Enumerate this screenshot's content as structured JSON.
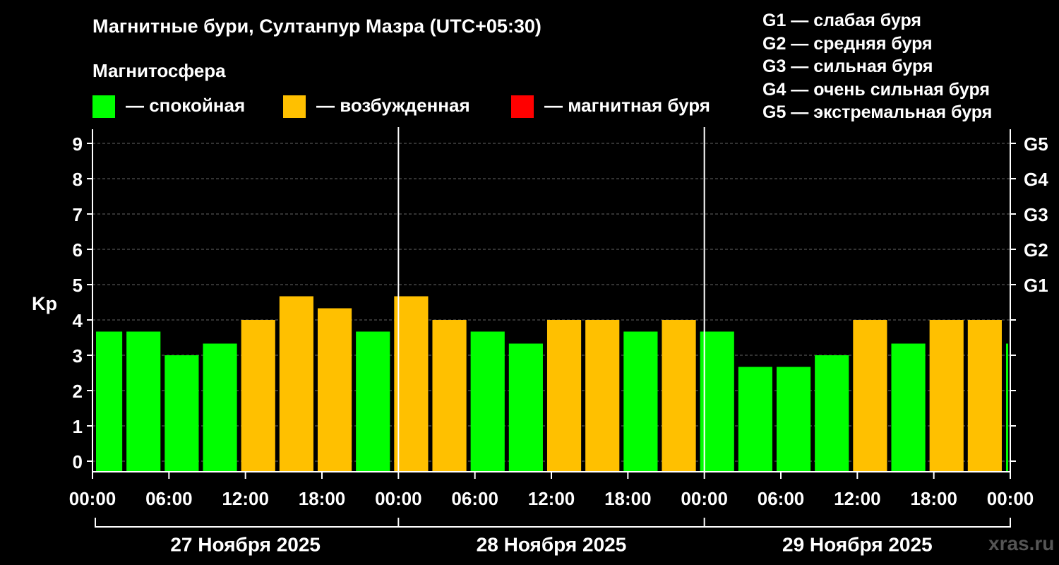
{
  "title": "Магнитные бури, Султанпур Мазра (UTC+05:30)",
  "magnetosphere_label": "Магнитосфера",
  "legend": [
    {
      "color": "#00ff00",
      "label": "— спокойная"
    },
    {
      "color": "#ffc000",
      "label": "— возбужденная"
    },
    {
      "color": "#ff0000",
      "label": "— магнитная буря"
    }
  ],
  "storm_levels": [
    "G1 — слабая буря",
    "G2 — средняя буря",
    "G3 — сильная буря",
    "G4 — очень сильная буря",
    "G5 — экстремальная буря"
  ],
  "watermark": "xras.ru",
  "chart_data": {
    "type": "bar",
    "ylabel": "Kp",
    "ylim": [
      -0.3,
      9.4
    ],
    "yticks": [
      "0",
      "1",
      "2",
      "3",
      "4",
      "5",
      "6",
      "7",
      "8",
      "9"
    ],
    "right_ticks": [
      {
        "value": 5,
        "label": "G1"
      },
      {
        "value": 6,
        "label": "G2"
      },
      {
        "value": 7,
        "label": "G3"
      },
      {
        "value": 8,
        "label": "G4"
      },
      {
        "value": 9,
        "label": "G5"
      }
    ],
    "grid": "horizontal dashed",
    "x_tick_labels": [
      "00:00",
      "06:00",
      "12:00",
      "18:00",
      "00:00",
      "06:00",
      "12:00",
      "18:00",
      "00:00",
      "06:00",
      "12:00",
      "18:00",
      "00:00"
    ],
    "days": [
      "27 Ноября 2025",
      "28 Ноября 2025",
      "29 Ноября 2025"
    ],
    "bars": [
      {
        "start_hour": 0,
        "end_hour": 2.5,
        "kp": 3.67,
        "state": "quiet"
      },
      {
        "start_hour": 2.5,
        "end_hour": 5.5,
        "kp": 3.67,
        "state": "quiet"
      },
      {
        "start_hour": 5.5,
        "end_hour": 8.5,
        "kp": 3.0,
        "state": "quiet"
      },
      {
        "start_hour": 8.5,
        "end_hour": 11.5,
        "kp": 3.33,
        "state": "quiet"
      },
      {
        "start_hour": 11.5,
        "end_hour": 14.5,
        "kp": 4.0,
        "state": "active"
      },
      {
        "start_hour": 14.5,
        "end_hour": 17.5,
        "kp": 4.67,
        "state": "active"
      },
      {
        "start_hour": 17.5,
        "end_hour": 20.5,
        "kp": 4.33,
        "state": "active"
      },
      {
        "start_hour": 20.5,
        "end_hour": 23.5,
        "kp": 3.67,
        "state": "quiet"
      },
      {
        "start_hour": 23.5,
        "end_hour": 26.5,
        "kp": 4.67,
        "state": "active"
      },
      {
        "start_hour": 26.5,
        "end_hour": 29.5,
        "kp": 4.0,
        "state": "active"
      },
      {
        "start_hour": 29.5,
        "end_hour": 32.5,
        "kp": 3.67,
        "state": "quiet"
      },
      {
        "start_hour": 32.5,
        "end_hour": 35.5,
        "kp": 3.33,
        "state": "quiet"
      },
      {
        "start_hour": 35.5,
        "end_hour": 38.5,
        "kp": 4.0,
        "state": "active"
      },
      {
        "start_hour": 38.5,
        "end_hour": 41.5,
        "kp": 4.0,
        "state": "active"
      },
      {
        "start_hour": 41.5,
        "end_hour": 44.5,
        "kp": 3.67,
        "state": "quiet"
      },
      {
        "start_hour": 44.5,
        "end_hour": 47.5,
        "kp": 4.0,
        "state": "active"
      },
      {
        "start_hour": 47.5,
        "end_hour": 50.5,
        "kp": 3.67,
        "state": "quiet"
      },
      {
        "start_hour": 50.5,
        "end_hour": 53.5,
        "kp": 2.67,
        "state": "quiet"
      },
      {
        "start_hour": 53.5,
        "end_hour": 56.5,
        "kp": 2.67,
        "state": "quiet"
      },
      {
        "start_hour": 56.5,
        "end_hour": 59.5,
        "kp": 3.0,
        "state": "quiet"
      },
      {
        "start_hour": 59.5,
        "end_hour": 62.5,
        "kp": 4.0,
        "state": "active"
      },
      {
        "start_hour": 62.5,
        "end_hour": 65.5,
        "kp": 3.33,
        "state": "quiet"
      },
      {
        "start_hour": 65.5,
        "end_hour": 68.5,
        "kp": 4.0,
        "state": "active"
      },
      {
        "start_hour": 68.5,
        "end_hour": 71.5,
        "kp": 4.0,
        "state": "active"
      },
      {
        "start_hour": 71.5,
        "end_hour": 72.0,
        "kp": 3.33,
        "state": "quiet"
      }
    ],
    "state_colors": {
      "quiet": "#00ff00",
      "active": "#ffc000",
      "storm": "#ff0000"
    }
  }
}
